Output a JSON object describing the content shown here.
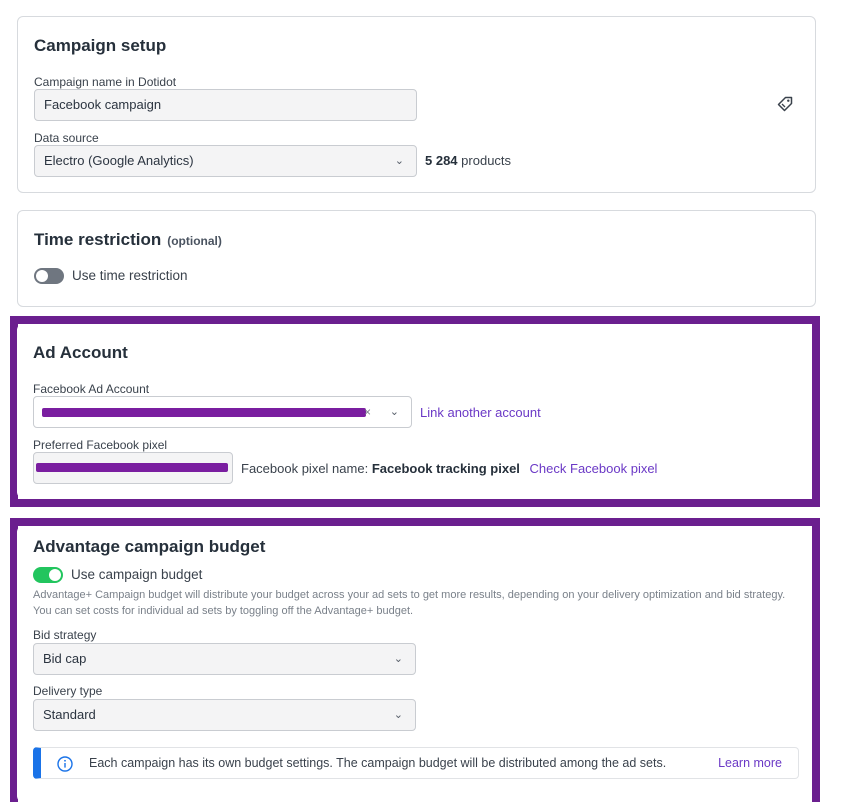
{
  "campaign_setup": {
    "title": "Campaign setup",
    "name_label": "Campaign name in Dotidot",
    "name_value": "Facebook campaign",
    "tag_icon": "tag-icon",
    "source_label": "Data source",
    "source_value": "Electro (Google Analytics)",
    "products_count": "5 284",
    "products_suffix": "products"
  },
  "time_restriction": {
    "title": "Time restriction",
    "optional": "(optional)",
    "toggle_label": "Use time restriction",
    "enabled": false
  },
  "ad_account": {
    "title": "Ad Account",
    "account_label": "Facebook Ad Account",
    "link_another": "Link another account",
    "pixel_label": "Preferred Facebook pixel",
    "pixel_name_prefix": "Facebook pixel name:",
    "pixel_name": "Facebook tracking pixel",
    "check_pixel": "Check Facebook pixel"
  },
  "budget": {
    "title": "Advantage campaign budget",
    "toggle_label": "Use campaign budget",
    "enabled": true,
    "description": "Advantage+ Campaign budget will distribute your budget across your ad sets to get more results, depending on your delivery optimization and bid strategy. You can set costs for individual ad sets by toggling off the Advantage+ budget.",
    "bid_label": "Bid strategy",
    "bid_value": "Bid cap",
    "delivery_label": "Delivery type",
    "delivery_value": "Standard",
    "info_text": "Each campaign has its own budget settings. The campaign budget will be distributed among the ad sets.",
    "learn_more": "Learn more"
  },
  "colors": {
    "highlight": "#6b1f8f",
    "link": "#6b39c6",
    "toggle_on": "#22c55e",
    "info_accent": "#1a73e8"
  }
}
